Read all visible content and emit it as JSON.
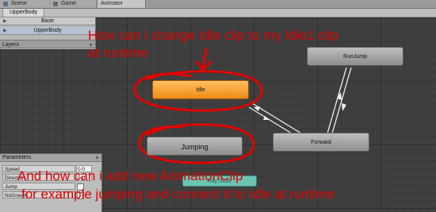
{
  "tabs": [
    {
      "label": "Scene",
      "icon": "scene-icon"
    },
    {
      "label": "Game",
      "icon": "game-icon"
    },
    {
      "label": "Animator",
      "icon": ""
    }
  ],
  "breadcrumb": "UpperBody",
  "layers": {
    "items": [
      "Base",
      "UpperBody"
    ],
    "header": "Layers",
    "add": "+"
  },
  "parameters": {
    "header": "Parameters",
    "add": "+",
    "rows": [
      {
        "name": "Speed",
        "value": "0.0"
      },
      {
        "name": "Direction",
        "value": "0.0"
      },
      {
        "name": "Jump",
        "value": ""
      },
      {
        "name": "NoGravity",
        "value": ""
      }
    ]
  },
  "states": {
    "idle": "Idle",
    "jumping": "Jumping",
    "forward": "Forward",
    "runjump": "RunJump",
    "hidden_node": "Ray State"
  },
  "annotations": {
    "line1": "How can i change Idle clip to my Idle1 clip",
    "line2": "at runtime",
    "line3": "And how can i add new AnimationClip",
    "line4": "for example jumping and connect it to Idle at runtime"
  },
  "colors": {
    "annotation": "#e10000",
    "idle_state": "#f39a22",
    "state": "#a5a5a5",
    "selected_layer": "#b6c2d3"
  }
}
